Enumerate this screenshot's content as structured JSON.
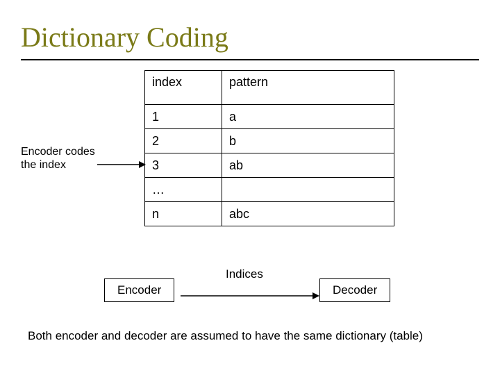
{
  "title": "Dictionary Coding",
  "side_label": "Encoder codes the index",
  "table": {
    "header": {
      "c0": "index",
      "c1": "pattern"
    },
    "rows": [
      {
        "c0": "1",
        "c1": "a"
      },
      {
        "c0": "2",
        "c1": "b"
      },
      {
        "c0": "3",
        "c1": "ab"
      },
      {
        "c0": "…",
        "c1": ""
      },
      {
        "c0": "n",
        "c1": "abc"
      }
    ]
  },
  "encoder_label": "Encoder",
  "decoder_label": "Decoder",
  "arrow_label": "Indices",
  "note": "Both encoder and decoder are assumed to have the same dictionary (table)",
  "colors": {
    "accent": "#7a7a17"
  }
}
